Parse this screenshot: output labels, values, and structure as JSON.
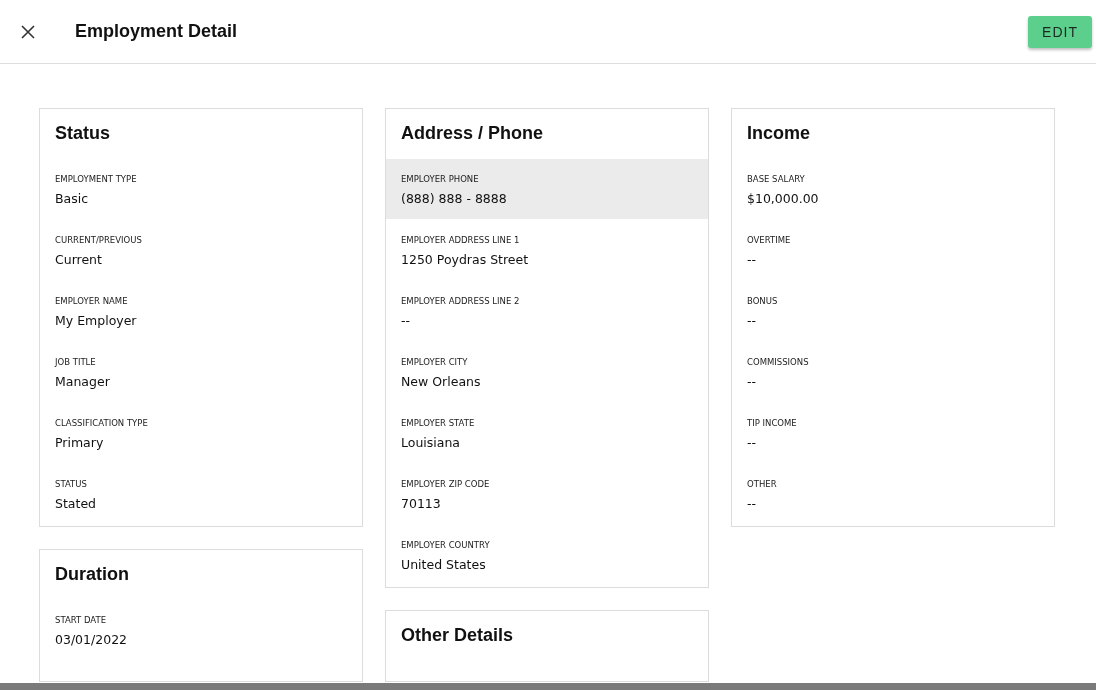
{
  "header": {
    "title": "Employment Detail",
    "edit_button": "EDIT"
  },
  "columns": [
    [
      {
        "title": "Status",
        "fields": [
          {
            "label": "EMPLOYMENT TYPE",
            "value": "Basic",
            "highlighted": false
          },
          {
            "label": "CURRENT/PREVIOUS",
            "value": "Current",
            "highlighted": false
          },
          {
            "label": "EMPLOYER NAME",
            "value": "My Employer",
            "highlighted": false
          },
          {
            "label": "JOB TITLE",
            "value": "Manager",
            "highlighted": false
          },
          {
            "label": "CLASSIFICATION TYPE",
            "value": "Primary",
            "highlighted": false
          },
          {
            "label": "STATUS",
            "value": "Stated",
            "highlighted": false
          }
        ]
      },
      {
        "title": "Duration",
        "fields": [
          {
            "label": "START DATE",
            "value": "03/01/2022",
            "highlighted": false
          }
        ]
      }
    ],
    [
      {
        "title": "Address / Phone",
        "fields": [
          {
            "label": "EMPLOYER PHONE",
            "value": "(888) 888 - 8888",
            "highlighted": true
          },
          {
            "label": "EMPLOYER ADDRESS LINE 1",
            "value": "1250 Poydras Street",
            "highlighted": false
          },
          {
            "label": "EMPLOYER ADDRESS LINE 2",
            "value": "--",
            "highlighted": false
          },
          {
            "label": "EMPLOYER CITY",
            "value": "New Orleans",
            "highlighted": false
          },
          {
            "label": "EMPLOYER STATE",
            "value": "Louisiana",
            "highlighted": false
          },
          {
            "label": "EMPLOYER ZIP CODE",
            "value": "70113",
            "highlighted": false
          },
          {
            "label": "EMPLOYER COUNTRY",
            "value": "United States",
            "highlighted": false
          }
        ]
      },
      {
        "title": "Other Details"
      }
    ],
    [
      {
        "title": "Income",
        "fields": [
          {
            "label": "BASE SALARY",
            "value": "$10,000.00",
            "highlighted": false
          },
          {
            "label": "OVERTIME",
            "value": "--",
            "highlighted": false
          },
          {
            "label": "BONUS",
            "value": "--",
            "highlighted": false
          },
          {
            "label": "COMMISSIONS",
            "value": "--",
            "highlighted": false
          },
          {
            "label": "TIP INCOME",
            "value": "--",
            "highlighted": false
          },
          {
            "label": "OTHER",
            "value": "--",
            "highlighted": false
          }
        ]
      }
    ]
  ]
}
